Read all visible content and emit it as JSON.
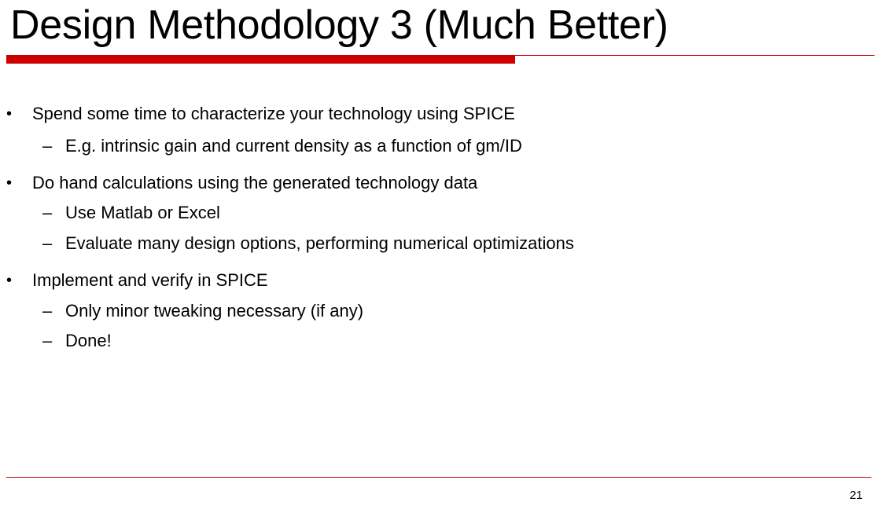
{
  "slide": {
    "title": "Design Methodology 3 (Much Better)",
    "page_number": "21"
  },
  "content": {
    "bullet_marker": "•",
    "sub_marker": "–",
    "items": [
      {
        "text": "Spend some time to characterize your technology using SPICE",
        "subitems": [
          "E.g. intrinsic gain and current density as a function of gm/ID"
        ]
      },
      {
        "text": "Do hand calculations using the generated technology data",
        "subitems": [
          "Use Matlab or Excel",
          "Evaluate many design options, performing numerical optimizations"
        ]
      },
      {
        "text": "Implement and verify in SPICE",
        "subitems": [
          "Only minor tweaking necessary (if any)",
          "Done!"
        ]
      }
    ]
  },
  "colors": {
    "accent": "#cc0000",
    "text": "#000000",
    "background": "#ffffff"
  }
}
